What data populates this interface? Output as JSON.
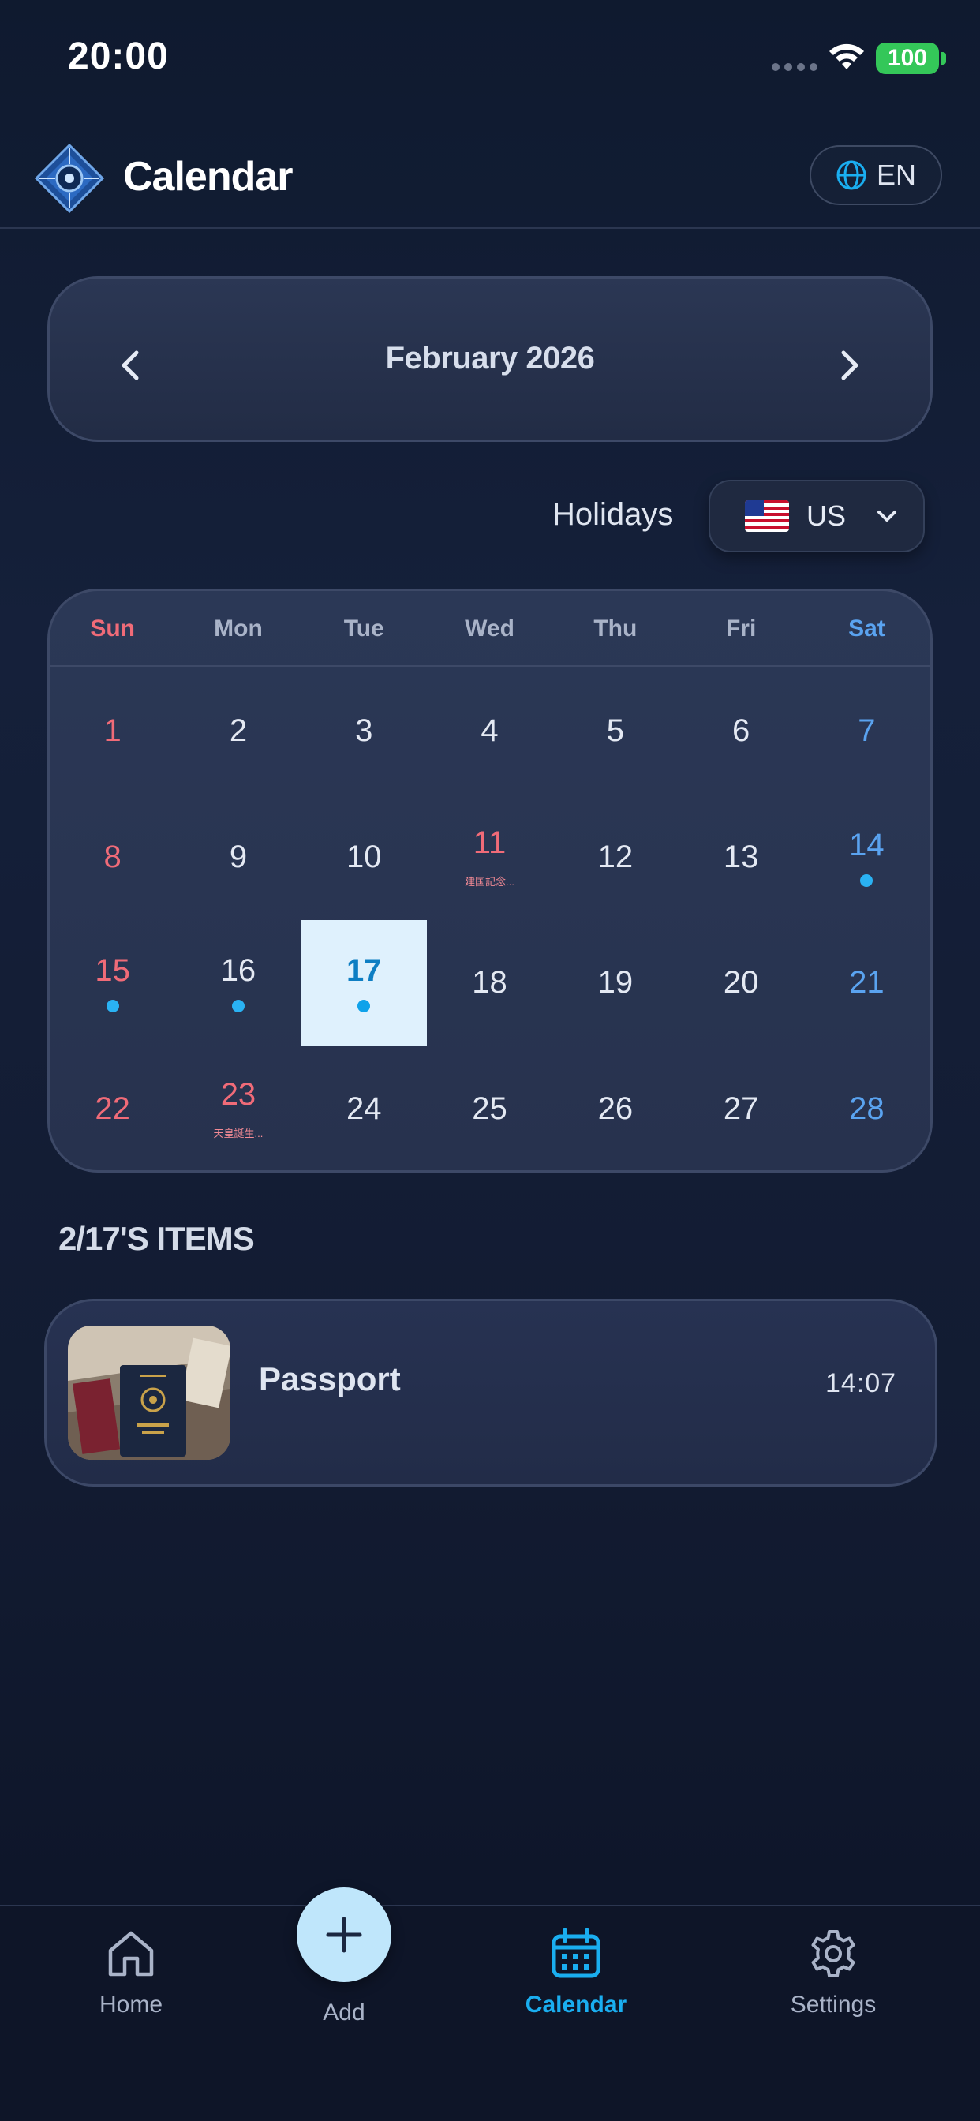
{
  "status_bar": {
    "time": "20:00",
    "battery": "100"
  },
  "header": {
    "title": "Calendar",
    "language": "EN"
  },
  "month_nav": {
    "label": "February 2026"
  },
  "holidays": {
    "label": "Holidays",
    "country": "US"
  },
  "calendar": {
    "weekdays": [
      "Sun",
      "Mon",
      "Tue",
      "Wed",
      "Thu",
      "Fri",
      "Sat"
    ],
    "weeks": [
      [
        {
          "d": "1"
        },
        {
          "d": "2"
        },
        {
          "d": "3"
        },
        {
          "d": "4"
        },
        {
          "d": "5"
        },
        {
          "d": "6"
        },
        {
          "d": "7"
        }
      ],
      [
        {
          "d": "8"
        },
        {
          "d": "9"
        },
        {
          "d": "10"
        },
        {
          "d": "11",
          "holiday": "建国記念..."
        },
        {
          "d": "12"
        },
        {
          "d": "13"
        },
        {
          "d": "14",
          "dot": true
        }
      ],
      [
        {
          "d": "15",
          "dot": true
        },
        {
          "d": "16",
          "dot": true
        },
        {
          "d": "17",
          "dot": true,
          "selected": true
        },
        {
          "d": "18"
        },
        {
          "d": "19"
        },
        {
          "d": "20"
        },
        {
          "d": "21"
        }
      ],
      [
        {
          "d": "22"
        },
        {
          "d": "23",
          "holiday": "天皇誕生..."
        },
        {
          "d": "24"
        },
        {
          "d": "25"
        },
        {
          "d": "26"
        },
        {
          "d": "27"
        },
        {
          "d": "28"
        }
      ]
    ]
  },
  "items": {
    "title": "2/17'S ITEMS",
    "list": [
      {
        "name": "Passport",
        "time": "14:07"
      }
    ]
  },
  "bottom_nav": {
    "home": "Home",
    "add": "Add",
    "calendar": "Calendar",
    "settings": "Settings"
  },
  "colors": {
    "accent": "#1aaef0",
    "sunday": "#f06b78",
    "saturday": "#5aa3f0",
    "selected_bg": "#dff1fd",
    "dot": "#2ab2f3"
  }
}
